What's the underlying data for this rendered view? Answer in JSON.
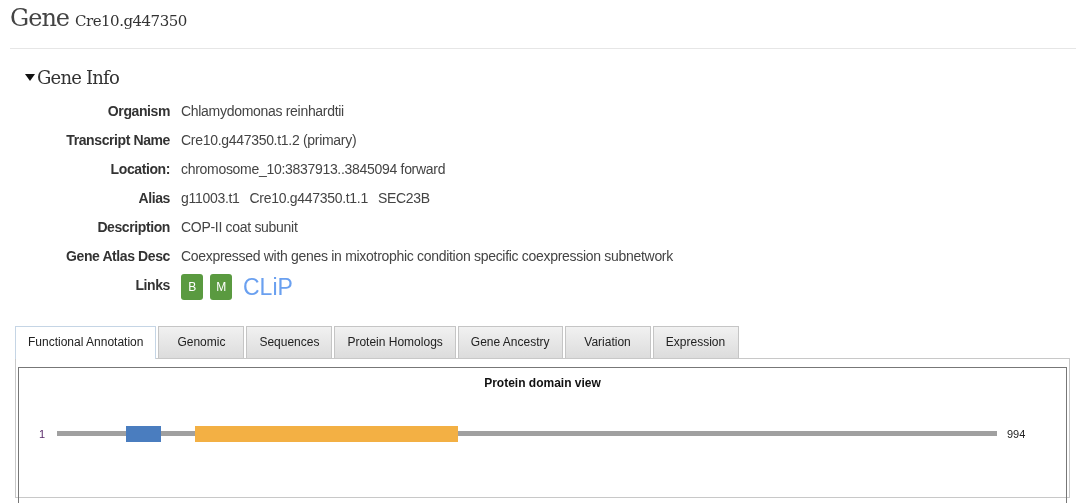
{
  "header": {
    "title": "Gene",
    "gene_id": "Cre10.g447350"
  },
  "section": {
    "title": "Gene Info",
    "expanded": true
  },
  "fields": [
    {
      "label": "Organism",
      "values": [
        "Chlamydomonas reinhardtii"
      ]
    },
    {
      "label": "Transcript Name",
      "values": [
        "Cre10.g447350.t1.2 (primary)"
      ]
    },
    {
      "label": "Location:",
      "values": [
        "chromosome_10:3837913..3845094 forward"
      ]
    },
    {
      "label": "Alias",
      "values": [
        "g11003.t1",
        "Cre10.g447350.t1.1",
        "SEC23B"
      ]
    },
    {
      "label": "Description",
      "values": [
        "COP-II coat subunit"
      ]
    },
    {
      "label": "Gene Atlas Desc",
      "values": [
        "Coexpressed with genes in mixotrophic condition specific coexpression subnetwork"
      ]
    }
  ],
  "links": {
    "label": "Links",
    "items": [
      {
        "kind": "badge",
        "text": "B"
      },
      {
        "kind": "badge",
        "text": "M"
      },
      {
        "kind": "logo",
        "text": "CLiP"
      }
    ]
  },
  "tabs": [
    {
      "label": "Functional Annotation",
      "selected": true
    },
    {
      "label": "Genomic",
      "selected": false
    },
    {
      "label": "Sequences",
      "selected": false
    },
    {
      "label": "Protein Homologs",
      "selected": false
    },
    {
      "label": "Gene Ancestry",
      "selected": false
    },
    {
      "label": "Variation",
      "selected": false
    },
    {
      "label": "Expression",
      "selected": false
    }
  ],
  "domain_view": {
    "title": "Protein domain view",
    "start": "1",
    "end": "994"
  }
}
